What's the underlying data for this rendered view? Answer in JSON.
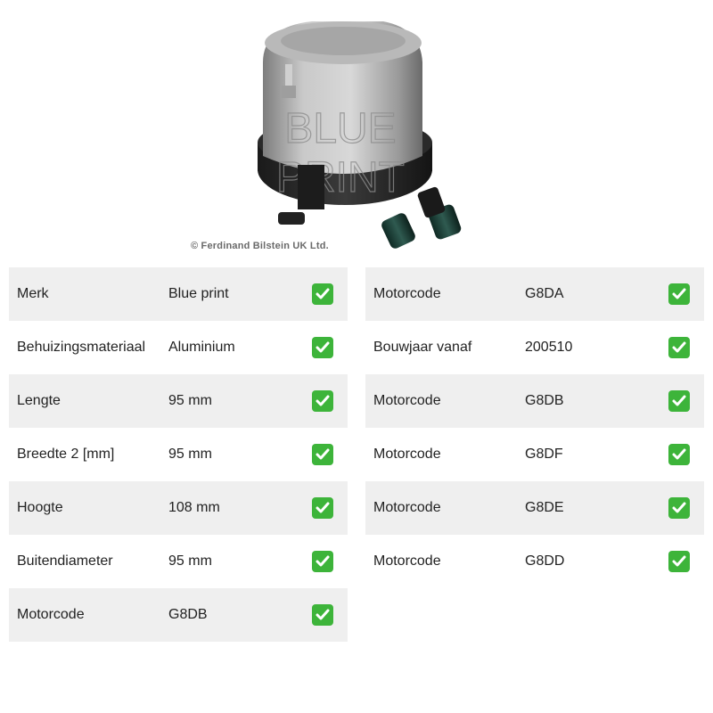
{
  "image": {
    "watermark": "BLUE PRINT",
    "copyright": "© Ferdinand Bilstein UK Ltd."
  },
  "colors": {
    "row_shade": "#efefef",
    "check_green": "#3db43a"
  },
  "icons": {
    "check": "check-mark-icon"
  },
  "specs_left": [
    {
      "label": "Merk",
      "value": "Blue print"
    },
    {
      "label": "Behuizingsmateriaal",
      "value": "Aluminium"
    },
    {
      "label": "Lengte",
      "value": "95 mm"
    },
    {
      "label": "Breedte 2 [mm]",
      "value": "95 mm"
    },
    {
      "label": "Hoogte",
      "value": "108 mm"
    },
    {
      "label": "Buitendiameter",
      "value": "95 mm"
    },
    {
      "label": "Motorcode",
      "value": "G8DB"
    }
  ],
  "specs_right": [
    {
      "label": "Motorcode",
      "value": "G8DA"
    },
    {
      "label": "Bouwjaar vanaf",
      "value": "200510"
    },
    {
      "label": "Motorcode",
      "value": "G8DB"
    },
    {
      "label": "Motorcode",
      "value": "G8DF"
    },
    {
      "label": "Motorcode",
      "value": "G8DE"
    },
    {
      "label": "Motorcode",
      "value": "G8DD"
    }
  ]
}
